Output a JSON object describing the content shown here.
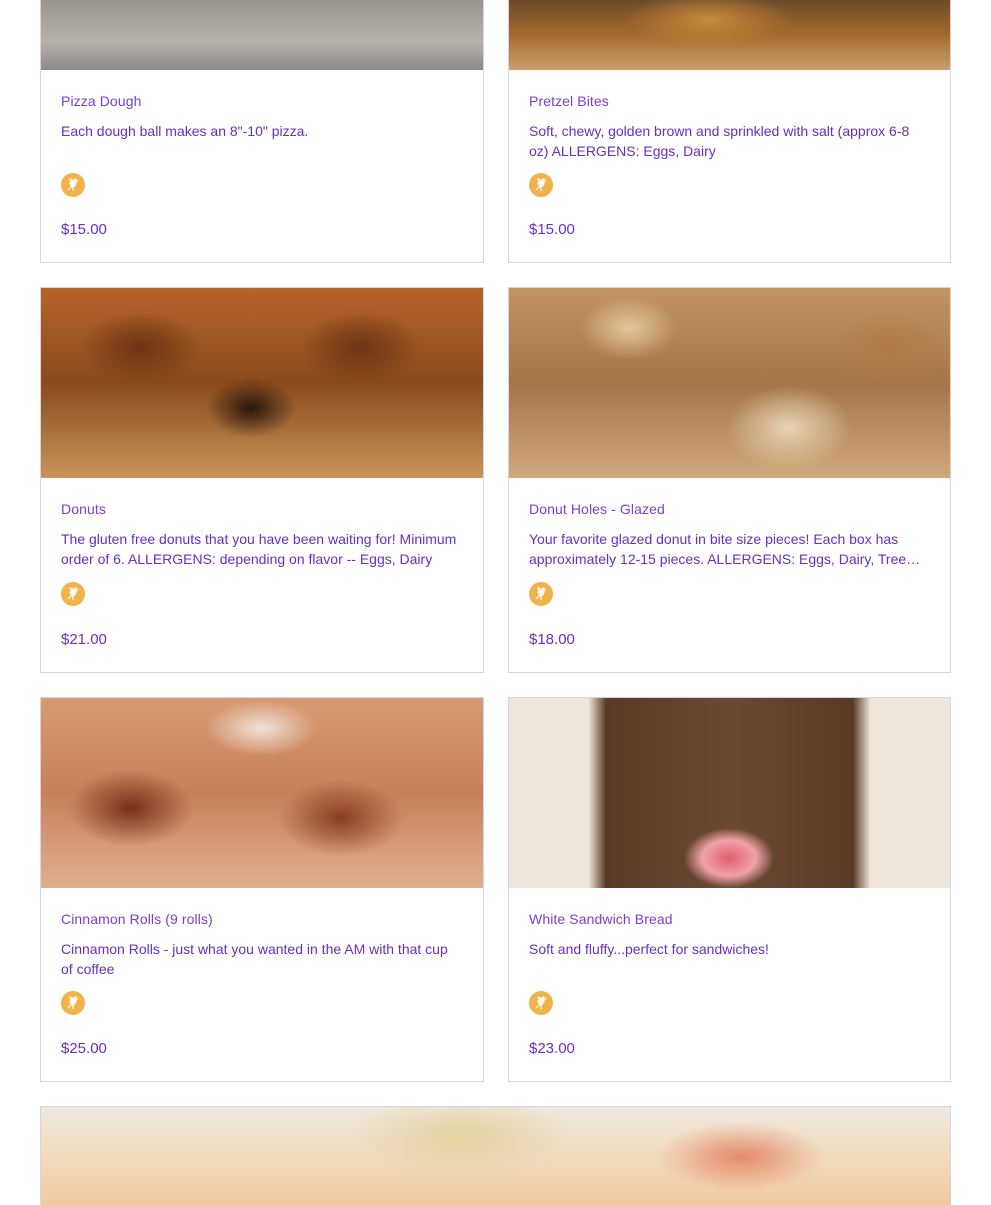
{
  "products": [
    {
      "title": "Pizza Dough",
      "desc": "Each dough ball makes an 8\"-10\" pizza.",
      "price": "$15.00",
      "badge_icon": "wheat-free-icon"
    },
    {
      "title": "Pretzel Bites",
      "desc": "Soft, chewy, golden brown and sprinkled with salt (approx 6-8 oz) ALLERGENS: Eggs, Dairy",
      "price": "$15.00",
      "badge_icon": "wheat-free-icon"
    },
    {
      "title": "Donuts",
      "desc": "The gluten free donuts that you have been waiting for! Minimum order of 6. ALLERGENS: depending on flavor -- Eggs, Dairy",
      "price": "$21.00",
      "badge_icon": "wheat-free-icon"
    },
    {
      "title": "Donut Holes - Glazed",
      "desc": "Your favorite glazed donut in bite size pieces! Each box has approximately 12-15 pieces. ALLERGENS: Eggs, Dairy, Tree Nuts",
      "price": "$18.00",
      "badge_icon": "wheat-free-icon"
    },
    {
      "title": "Cinnamon Rolls (9 rolls)",
      "desc": "Cinnamon Rolls - just what you wanted in the AM with that cup of coffee",
      "price": "$25.00",
      "badge_icon": "wheat-free-icon"
    },
    {
      "title": "White Sandwich Bread",
      "desc": "Soft and fluffy...perfect for sandwiches!",
      "price": "$23.00",
      "badge_icon": "wheat-free-icon"
    }
  ],
  "colors": {
    "accent": "#6a2ec2",
    "badge": "#f0b24b",
    "border": "#d9d3df"
  }
}
